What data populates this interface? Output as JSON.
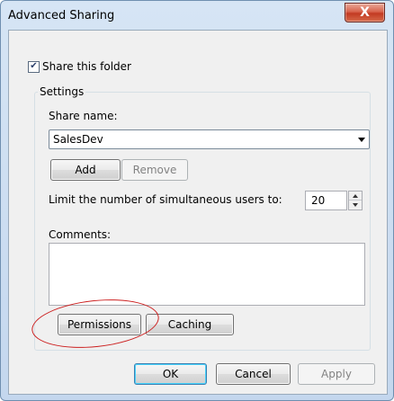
{
  "window": {
    "title": "Advanced Sharing",
    "close_icon": "close-icon",
    "close_glyph": "X"
  },
  "share": {
    "checkbox_label": "Share this folder",
    "checked": true,
    "check_glyph": "✔"
  },
  "settings": {
    "group_label": "Settings",
    "share_name_label": "Share name:",
    "share_name_value": "SalesDev",
    "add_label": "Add",
    "remove_label": "Remove",
    "limit_label": "Limit the number of simultaneous users to:",
    "limit_value": "20",
    "comments_label": "Comments:",
    "comments_value": "",
    "permissions_label": "Permissions",
    "caching_label": "Caching"
  },
  "footer": {
    "ok_label": "OK",
    "cancel_label": "Cancel",
    "apply_label": "Apply"
  },
  "annotation": {
    "color": "#cc1f1f"
  }
}
